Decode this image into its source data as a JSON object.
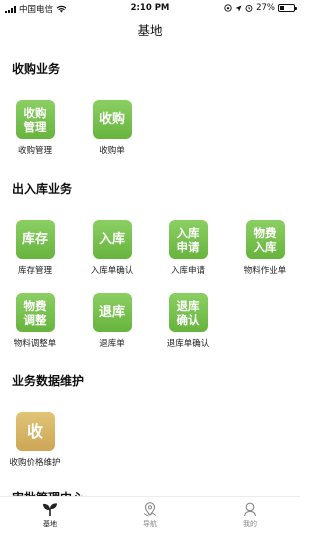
{
  "status_bar": {
    "carrier": "中国电信",
    "time": "2:10 PM",
    "battery": "27%",
    "battery_level": 0.27
  },
  "header": {
    "title": "基地"
  },
  "sections": [
    {
      "title": "收购业务",
      "tiles": [
        {
          "icon_text": "收购\n管理",
          "label": "收购管理",
          "color": "#7cc353"
        },
        {
          "icon_text": "收购",
          "label": "收购单",
          "color": "#7cc353"
        }
      ]
    },
    {
      "title": "出入库业务",
      "tiles": [
        {
          "icon_text": "库存",
          "label": "库存管理",
          "color": "#7cc353"
        },
        {
          "icon_text": "入库",
          "label": "入库单确认",
          "color": "#7cc353"
        },
        {
          "icon_text": "入库\n申请",
          "label": "入库申请",
          "color": "#7cc353"
        },
        {
          "icon_text": "物费\n入库",
          "label": "物料作业单",
          "color": "#7cc353"
        },
        {
          "icon_text": "物费\n调整",
          "label": "物料调整单",
          "color": "#7cc353"
        },
        {
          "icon_text": "退库",
          "label": "退库单",
          "color": "#7cc353"
        },
        {
          "icon_text": "退库\n确认",
          "label": "退库单确认",
          "color": "#7cc353"
        }
      ]
    },
    {
      "title": "业务数据维护",
      "tiles": [
        {
          "icon_text": "收",
          "label": "收购价格维护",
          "color": "#d8b765"
        }
      ]
    },
    {
      "title": "审批管理中心",
      "tiles": []
    }
  ],
  "tabbar": {
    "items": [
      {
        "label": "基地",
        "icon": "sprout-icon",
        "active": true
      },
      {
        "label": "导航",
        "icon": "map-pin-icon",
        "active": false
      },
      {
        "label": "我的",
        "icon": "user-icon",
        "active": false
      }
    ]
  }
}
